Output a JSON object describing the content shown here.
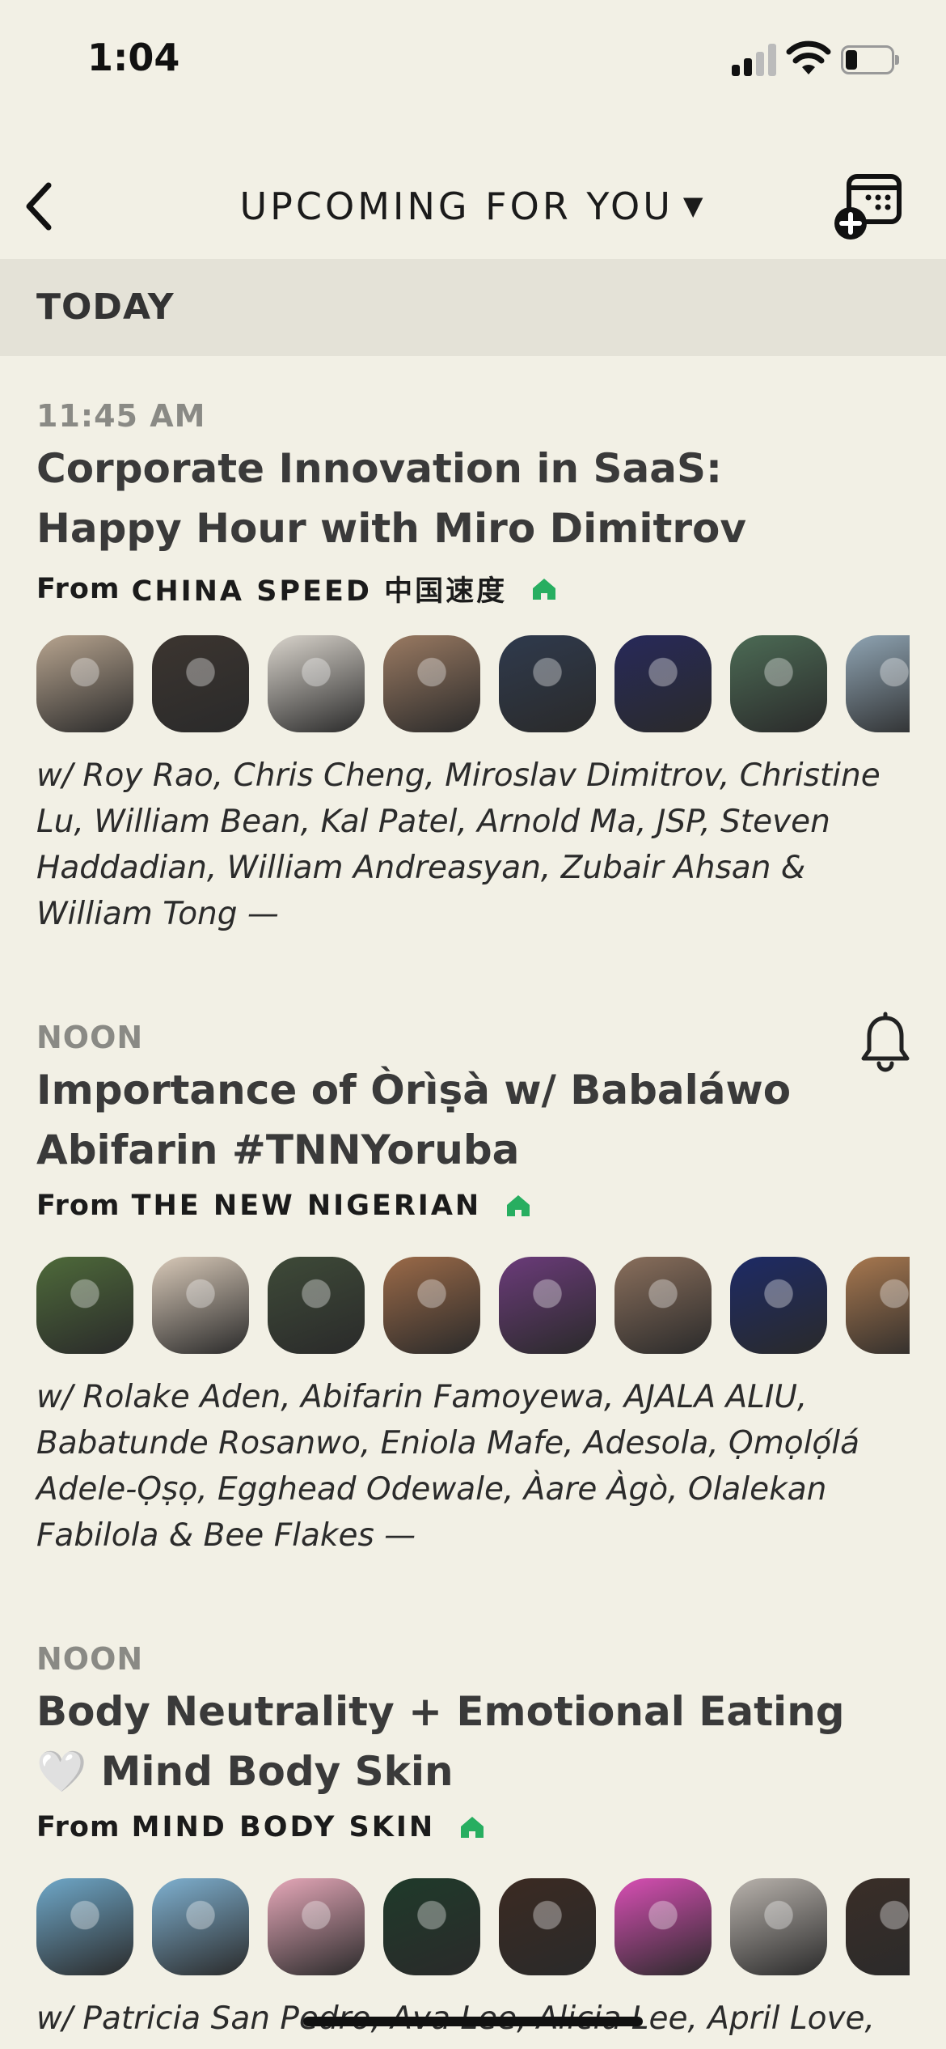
{
  "status_bar": {
    "time": "1:04",
    "icons": [
      "signal-icon",
      "wifi-icon",
      "battery-icon"
    ]
  },
  "nav": {
    "title": "UPCOMING FOR YOU",
    "caret": "▼",
    "icons": [
      "back-chevron-icon",
      "calendar-add-icon"
    ]
  },
  "section": {
    "label": "TODAY"
  },
  "events": [
    {
      "time": "11:45 AM",
      "title": "Corporate Innovation in SaaS: Happy Hour with Miro Dimitrov",
      "club_prefix": "From",
      "club": "CHINA SPEED 中国速度",
      "speakers": "w/ Roy Rao, Chris Cheng, Miroslav Dimitrov, Christine Lu, William Bean, Kal Patel, Arnold Ma, JSP, Steven Haddadian, William Andreasyan, Zubair Ahsan & William Tong —",
      "avatar_colors": [
        "#b7a48f",
        "#3c3530",
        "#d9d4cc",
        "#9a7a62",
        "#2f3a4d",
        "#27295a",
        "#4c6b55",
        "#8fa4b3"
      ]
    },
    {
      "time": "NOON",
      "title": "Importance of Òrìṣà w/ Babaláwo Abifarin #TNNYoruba",
      "club_prefix": "From",
      "club": "THE NEW NIGERIAN",
      "speakers": "w/ Rolake Aden, Abifarin Famoyewa, AJALA ALIU, Babatunde Rosanwo, Eniola Mafe, Adesola, Ọmọlọ́lá Adele-Ọṣọ, Egghead Odewale, Àare Àgò, Olalekan Fabilola & Bee Flakes —",
      "avatar_colors": [
        "#4e6a3a",
        "#d8c9b8",
        "#3e4a38",
        "#9b6a48",
        "#6b3b7a",
        "#8a6f5c",
        "#1d2a66",
        "#a8784f"
      ]
    },
    {
      "time": "NOON",
      "title": "Body Neutrality + Emotional Eating 🤍 Mind Body Skin",
      "club_prefix": "From",
      "club": "MIND BODY SKIN",
      "speakers": "w/ Patricia San Pedro, Ava Lee, Alicia Lee, April Love,",
      "avatar_colors": [
        "#6fa8c9",
        "#7fb1d1",
        "#e6a8b9",
        "#1f3a2a",
        "#3b2a22",
        "#d94fb5",
        "#b9b3ad",
        "#3a2e28"
      ]
    }
  ],
  "colors": {
    "background": "#f2f0e5",
    "section_bg": "#e4e2d7",
    "house_green": "#27ae60"
  }
}
